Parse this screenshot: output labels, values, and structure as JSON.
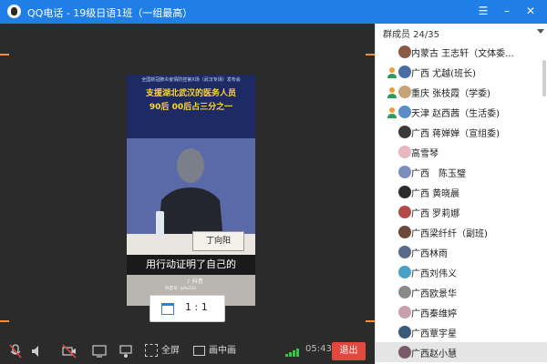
{
  "window": {
    "title": "QQ电话 - 19级日语1班（一组最高）"
  },
  "video": {
    "small_caption": "全国新冠肺炎疫情防控第X场（武汉专场）发布会",
    "caption_line1": "支援湖北武汉的医务人员",
    "caption_line2": "90后 00后占三分之一",
    "nameplate": "丁向阳",
    "subtitle": "用行动证明了自己的",
    "douyin_label": "抖音",
    "douyin_id": "抖音号: yzlv333"
  },
  "aspect_button": {
    "label": "1 : 1"
  },
  "toolbar": {
    "fullscreen_label": "全屏",
    "pip_label": "画中画",
    "time": "05:43",
    "exit_label": "退出",
    "signal_color": "#2ecc40",
    "exit_color": "#e2483d"
  },
  "sidebar": {
    "header": "群成员 24/35",
    "members": [
      {
        "name": "内蒙古 王志轩（文体委...",
        "role": "none",
        "avatar": "#8a5a44"
      },
      {
        "name": "广西 尤越(班长)",
        "role": "manager",
        "avatar": "#4a6fa5"
      },
      {
        "name": "重庆 张枝霞（学委)",
        "role": "manager",
        "avatar": "#c7a27a"
      },
      {
        "name": "天津 赵西茜（生活委)",
        "role": "manager",
        "avatar": "#5a8cc8"
      },
      {
        "name": "广西 蒋婵婵（宣组委)",
        "role": "none",
        "avatar": "#3a3a3a"
      },
      {
        "name": "高雪琴",
        "role": "none",
        "avatar": "#e8b7c0"
      },
      {
        "name": "广西　陈玉璧",
        "role": "none",
        "avatar": "#7a8fbf"
      },
      {
        "name": "广西 黄晓晨",
        "role": "none",
        "avatar": "#2c2c2c"
      },
      {
        "name": "广西 罗莉娜",
        "role": "none",
        "avatar": "#b54a4a"
      },
      {
        "name": "广西梁纤纤（副班)",
        "role": "none",
        "avatar": "#6b4a3a"
      },
      {
        "name": "广西林雨",
        "role": "none",
        "avatar": "#5a6a8a"
      },
      {
        "name": "广西刘伟义",
        "role": "none",
        "avatar": "#4aa0c8"
      },
      {
        "name": "广西欧景华",
        "role": "none",
        "avatar": "#8a8a8a"
      },
      {
        "name": "广西秦维婷",
        "role": "none",
        "avatar": "#c8a0b0"
      },
      {
        "name": "广西覃宇星",
        "role": "none",
        "avatar": "#3a5a7a"
      },
      {
        "name": "广西赵小慧",
        "role": "none",
        "avatar": "#7a5a6a",
        "selected": true
      }
    ]
  }
}
